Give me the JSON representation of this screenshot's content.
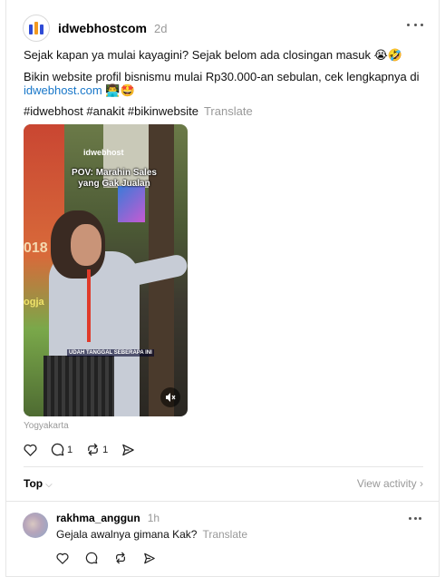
{
  "post": {
    "username": "idwebhostcom",
    "timestamp": "2d",
    "line1": "Sejak kapan ya mulai kayagini? Sejak belom ada closingan masuk 😭🤣",
    "line2": "Bikin website profil bisnismu mulai Rp30.000-an sebulan, cek lengkapnya di",
    "link": "idwebhost.com",
    "link_emoji": " 👨‍💻🤩",
    "hashtags": "#idwebhost #anakit #bikinwebsite",
    "translate": "Translate",
    "location": "Yogyakarta",
    "video": {
      "brand": "idwebhost",
      "caption_line1": "POV: Marahin Sales",
      "caption_line2": "yang Gak Jualan",
      "subtitle": "UDAH TANGGAL SEBERAPA INI",
      "background_text_1": "018",
      "background_text_2": "ogja"
    },
    "actions": {
      "like_icon": "heart-icon",
      "comment_count": "1",
      "repost_count": "1",
      "share_icon": "send-icon"
    }
  },
  "sort": {
    "label": "Top",
    "view_activity": "View activity"
  },
  "reply": {
    "username": "rakhma_anggun",
    "timestamp": "1h",
    "text": "Gejala awalnya gimana Kak?",
    "translate": "Translate"
  },
  "colors": {
    "link": "#1877c9",
    "muted": "#999999",
    "brand_blue": "#2f4bd6",
    "brand_orange": "#f29a1f"
  }
}
